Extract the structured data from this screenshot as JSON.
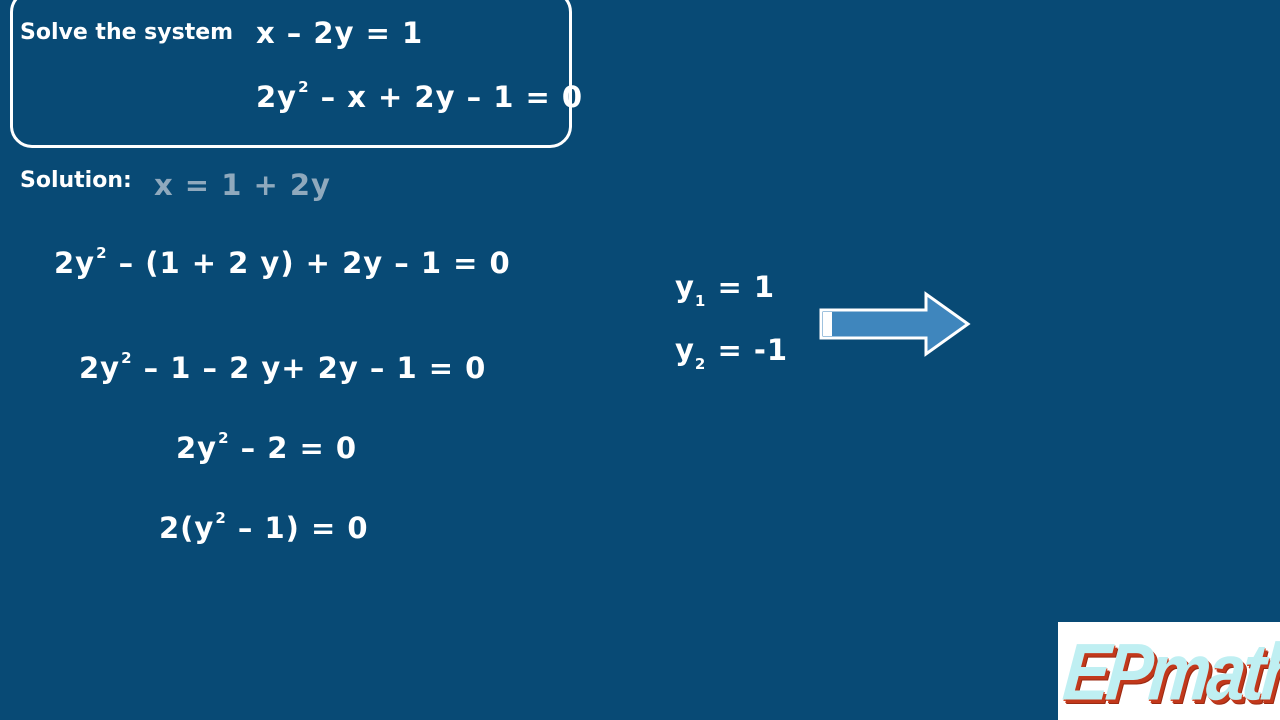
{
  "problem": {
    "label": "Solve the system",
    "eq1": "x – 2y = 1",
    "eq2_pre": "2y",
    "eq2_sup": "2",
    "eq2_post": " – x + 2y – 1 = 0"
  },
  "solution": {
    "label": "Solution:",
    "substitution": "x = 1 + 2y",
    "steps": [
      {
        "pre": "2y",
        "sup": "2",
        "post": " – (1 + 2 y) + 2y – 1 = 0"
      },
      {
        "pre": "2y",
        "sup": "2",
        "post": " – 1 – 2 y+ 2y – 1 = 0"
      },
      {
        "pre": "2y",
        "sup": "2",
        "post": " – 2 = 0"
      },
      {
        "pre": "2(y",
        "sup": "2",
        "post": " – 1) = 0"
      }
    ]
  },
  "results": [
    {
      "var": "y",
      "sub": "1",
      "value": " = 1"
    },
    {
      "var": "y",
      "sub": "2",
      "value": " = -1"
    }
  ],
  "arrow": {
    "icon": "right-arrow-icon",
    "fill": "#3f86bd",
    "stroke": "#ffffff"
  },
  "logo": {
    "text": "EPmathic"
  },
  "colors": {
    "background": "#084a75",
    "text": "#ffffff",
    "faded": "#8fa9bd"
  }
}
